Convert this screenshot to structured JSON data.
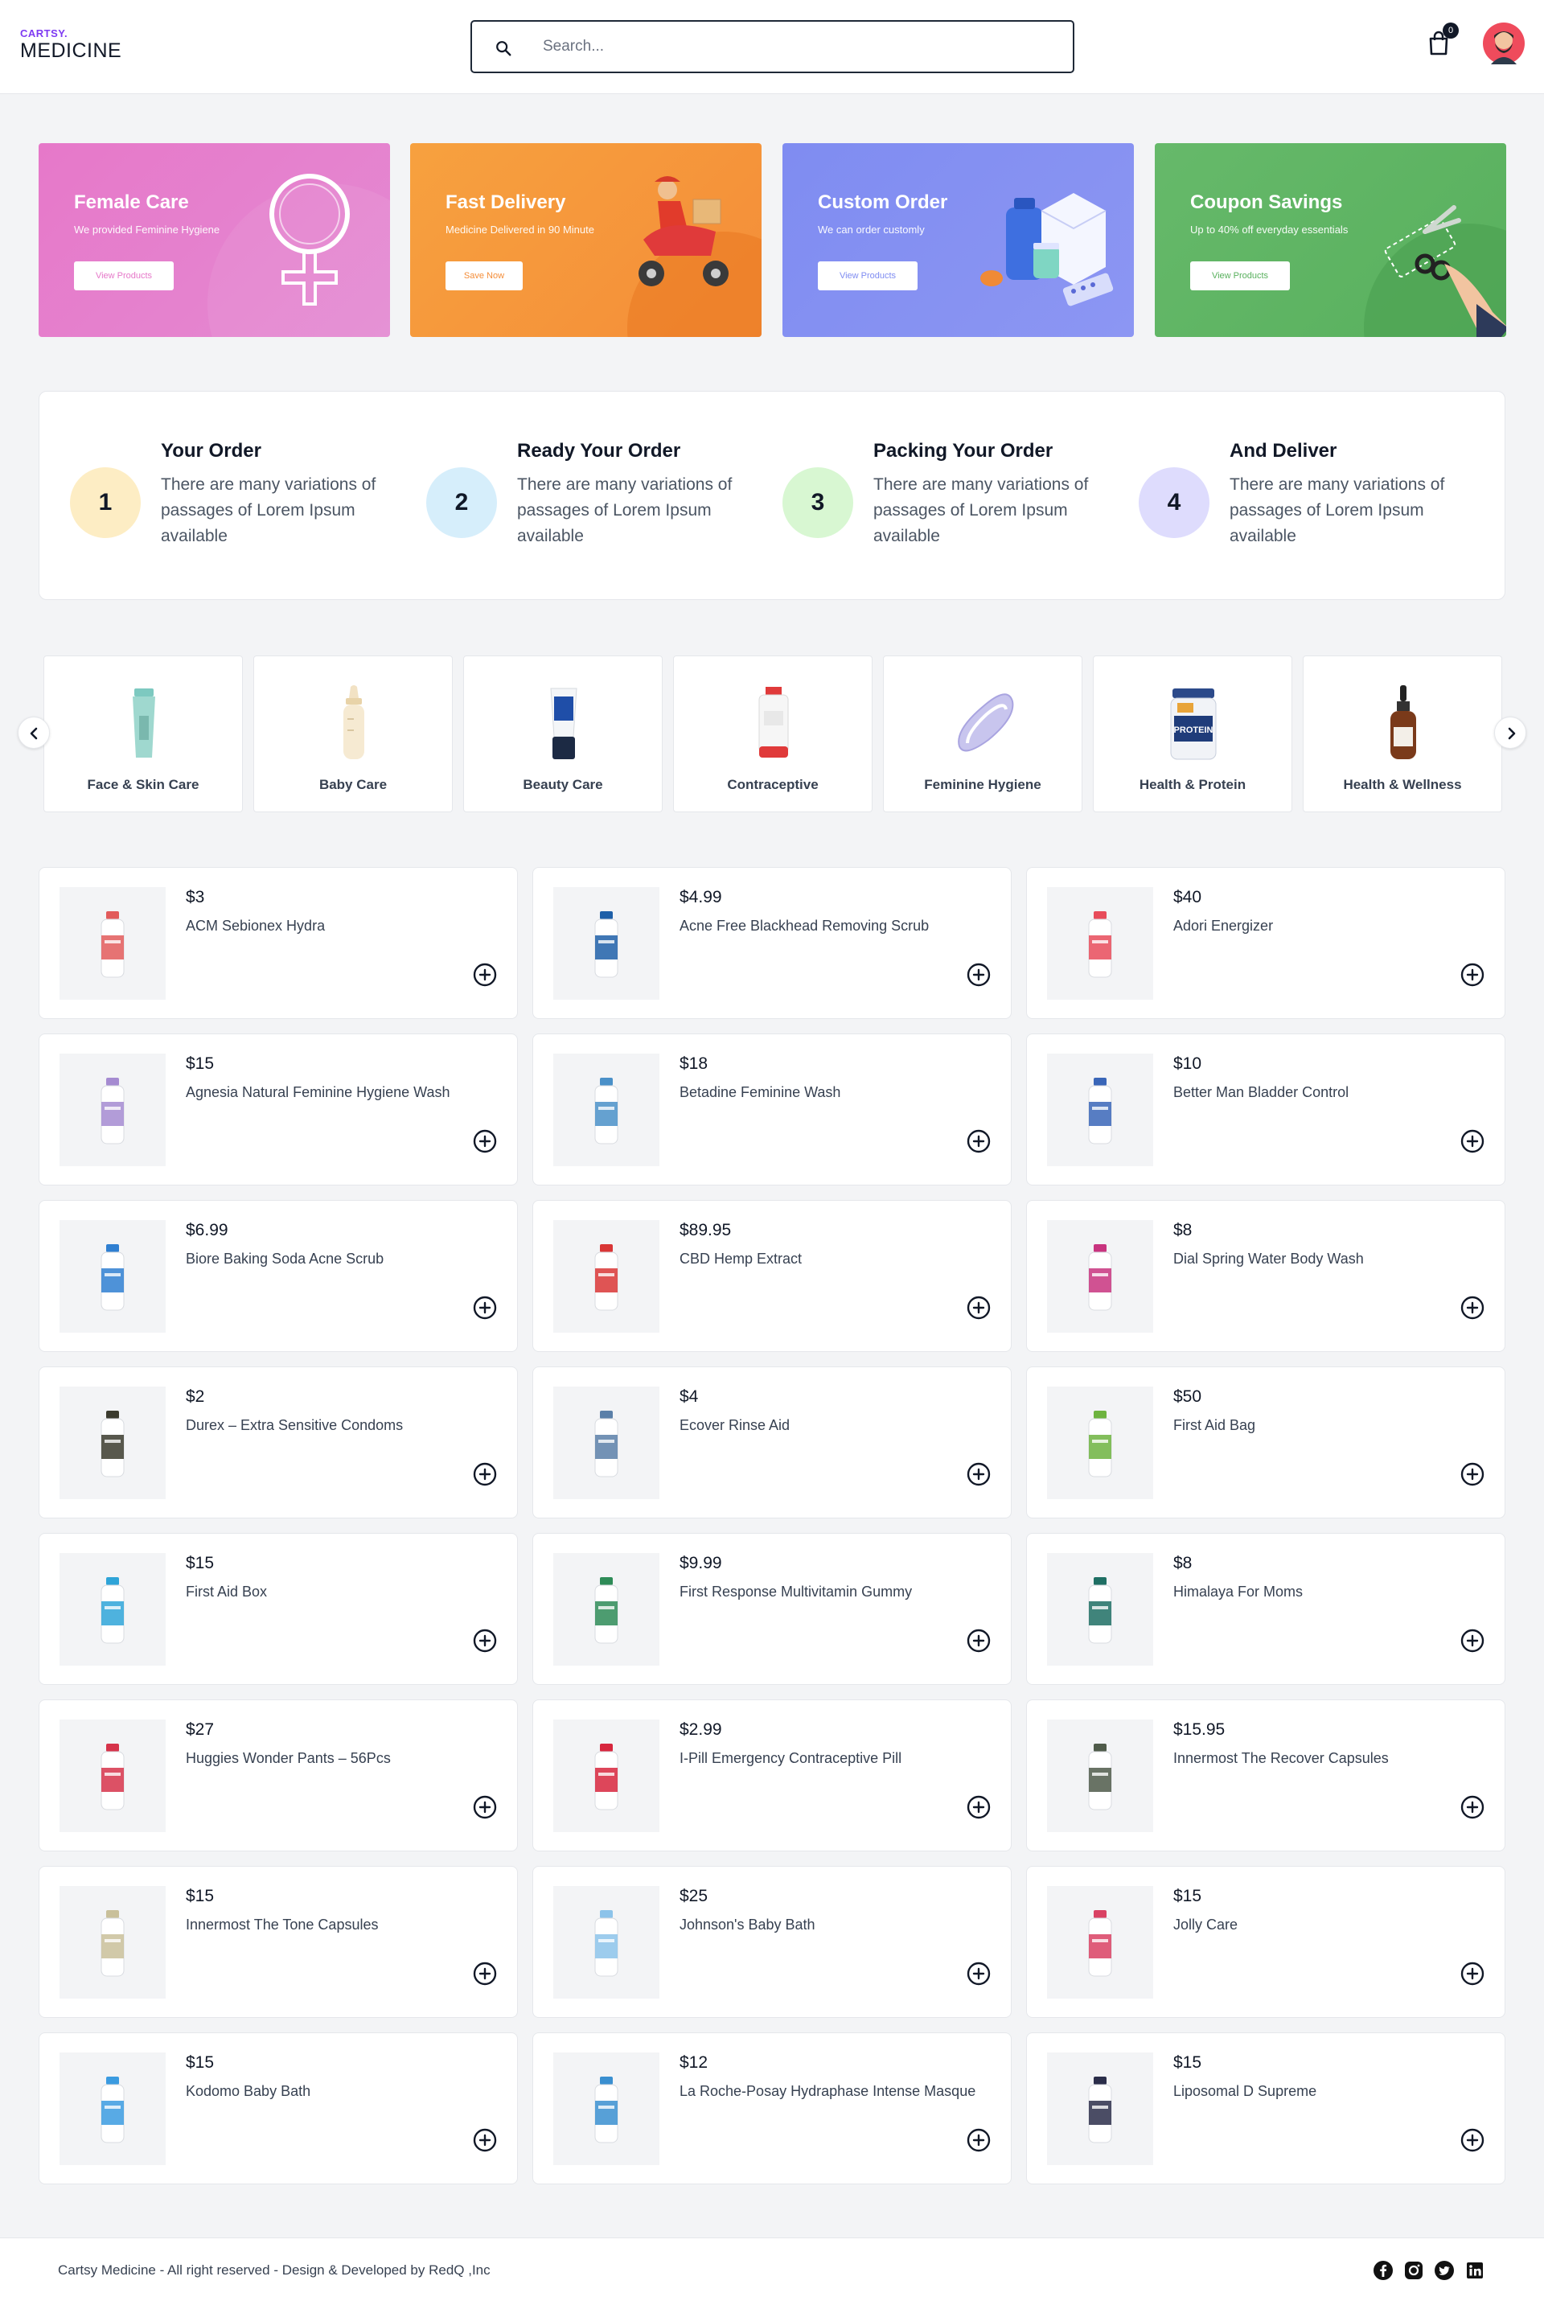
{
  "header": {
    "logo_top": "CARTSY.",
    "logo_bottom": "MEDICINE",
    "search_placeholder": "Search...",
    "cart_count": "0"
  },
  "banners": [
    {
      "title": "Female Care",
      "subtitle": "We provided Feminine Hygiene",
      "button": "View Products",
      "color": "#e47ac8"
    },
    {
      "title": "Fast Delivery",
      "subtitle": "Medicine Delivered in 90 Minute",
      "button": "Save Now",
      "color": "#f59a3e"
    },
    {
      "title": "Custom Order",
      "subtitle": "We can order customly",
      "button": "View Products",
      "color": "#7d8cf0"
    },
    {
      "title": "Coupon Savings",
      "subtitle": "Up to 40% off everyday essentials",
      "button": "View Products",
      "color": "#5fb563"
    }
  ],
  "steps": [
    {
      "num": "1",
      "title": "Your Order",
      "desc": "There are many variations of passages of Lorem Ipsum available",
      "color": "#fdedc4"
    },
    {
      "num": "2",
      "title": "Ready Your Order",
      "desc": "There are many variations of passages of Lorem Ipsum available",
      "color": "#d6eefb"
    },
    {
      "num": "3",
      "title": "Packing Your Order",
      "desc": "There are many variations of passages of Lorem Ipsum available",
      "color": "#d8f7d2"
    },
    {
      "num": "4",
      "title": "And Deliver",
      "desc": "There are many variations of passages of Lorem Ipsum available",
      "color": "#dedcfd"
    }
  ],
  "categories": [
    {
      "label": "Face & Skin Care",
      "icon": "tube-icon"
    },
    {
      "label": "Baby Care",
      "icon": "baby-bottle-icon"
    },
    {
      "label": "Beauty Care",
      "icon": "cream-tube-icon"
    },
    {
      "label": "Contraceptive",
      "icon": "bottle-icon"
    },
    {
      "label": "Feminine Hygiene",
      "icon": "pad-icon"
    },
    {
      "label": "Health & Protein",
      "icon": "protein-jar-icon"
    },
    {
      "label": "Health & Wellness",
      "icon": "dropper-bottle-icon"
    }
  ],
  "products": [
    {
      "price": "$3",
      "name": "ACM Sebionex Hydra",
      "color": "#e25b5b"
    },
    {
      "price": "$4.99",
      "name": "Acne Free Blackhead Removing Scrub",
      "color": "#1e5fa8"
    },
    {
      "price": "$40",
      "name": "Adori Energizer",
      "color": "#e84b5a"
    },
    {
      "price": "$15",
      "name": "Agnesia Natural Feminine Hygiene Wash",
      "color": "#a58bd1"
    },
    {
      "price": "$18",
      "name": "Betadine Feminine Wash",
      "color": "#4a90c8"
    },
    {
      "price": "$10",
      "name": "Better Man Bladder Control",
      "color": "#3a66b8"
    },
    {
      "price": "$6.99",
      "name": "Biore Baking Soda Acne Scrub",
      "color": "#2f7fd1"
    },
    {
      "price": "$89.95",
      "name": "CBD Hemp Extract",
      "color": "#d93636"
    },
    {
      "price": "$8",
      "name": "Dial Spring Water Body Wash",
      "color": "#c8347f"
    },
    {
      "price": "$2",
      "name": "Durex – Extra Sensitive Condoms",
      "color": "#3b3b2e"
    },
    {
      "price": "$4",
      "name": "Ecover Rinse Aid",
      "color": "#5a7fa8"
    },
    {
      "price": "$50",
      "name": "First Aid Bag",
      "color": "#6db33f"
    },
    {
      "price": "$15",
      "name": "First Aid Box",
      "color": "#2fa4d8"
    },
    {
      "price": "$9.99",
      "name": "First Response Multivitamin Gummy",
      "color": "#2e8b57"
    },
    {
      "price": "$8",
      "name": "Himalaya For Moms",
      "color": "#1f6f64"
    },
    {
      "price": "$27",
      "name": "Huggies Wonder Pants – 56Pcs",
      "color": "#d6334a"
    },
    {
      "price": "$2.99",
      "name": "I-Pill Emergency Contraceptive Pill",
      "color": "#d7263d"
    },
    {
      "price": "$15.95",
      "name": "Innermost The Recover Capsules",
      "color": "#4f5b4a"
    },
    {
      "price": "$15",
      "name": "Innermost The Tone Capsules",
      "color": "#c9c09a"
    },
    {
      "price": "$25",
      "name": "Johnson's Baby Bath",
      "color": "#8cc3ea"
    },
    {
      "price": "$15",
      "name": "Jolly Care",
      "color": "#d94163"
    },
    {
      "price": "$15",
      "name": "Kodomo Baby Bath",
      "color": "#3b9be0"
    },
    {
      "price": "$12",
      "name": "La Roche-Posay Hydraphase Intense Masque",
      "color": "#3a8fd0"
    },
    {
      "price": "$15",
      "name": "Liposomal D Supreme",
      "color": "#2b2e4a"
    }
  ],
  "footer": {
    "copyright": "Cartsy Medicine - All right reserved - Design & Developed by RedQ ,Inc",
    "socials": [
      "facebook-icon",
      "instagram-icon",
      "twitter-icon",
      "linkedin-icon"
    ]
  }
}
